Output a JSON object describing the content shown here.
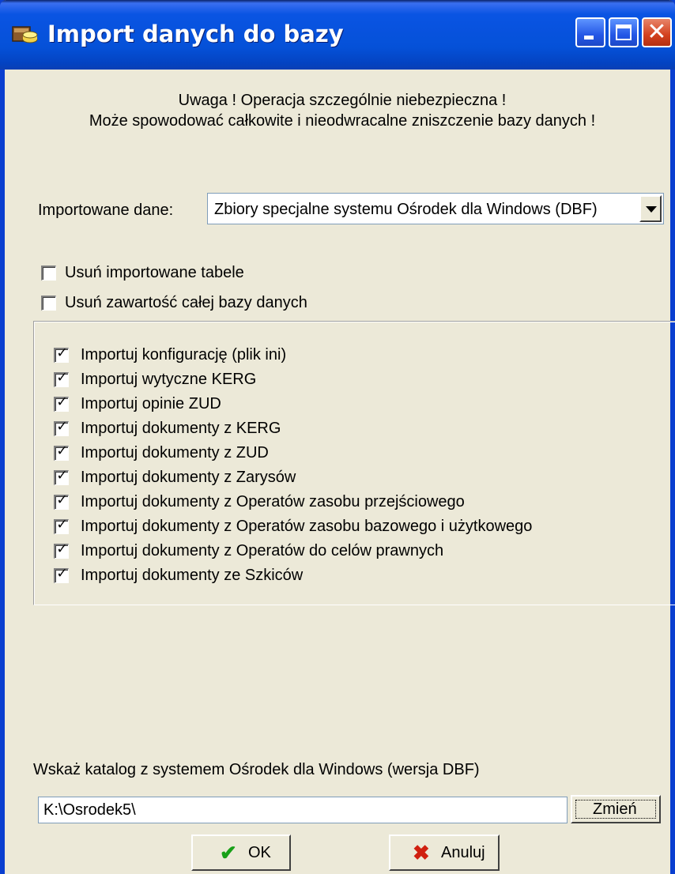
{
  "window": {
    "title": "Import danych do bazy"
  },
  "warning": {
    "line1": "Uwaga ! Operacja szczególnie niebezpieczna !",
    "line2": "Może spowodować całkowite i nieodwracalne zniszczenie bazy danych !"
  },
  "import": {
    "label": "Importowane dane:",
    "selected": "Zbiory specjalne systemu Ośrodek dla Windows (DBF)"
  },
  "options": [
    {
      "label": "Usuń importowane tabele",
      "checked": false
    },
    {
      "label": "Usuń zawartość całej bazy danych",
      "checked": false
    }
  ],
  "import_items": [
    {
      "label": "Importuj konfigurację (plik ini)",
      "checked": true
    },
    {
      "label": "Importuj wytyczne KERG",
      "checked": true
    },
    {
      "label": "Importuj opinie ZUD",
      "checked": true
    },
    {
      "label": "Importuj dokumenty z KERG",
      "checked": true
    },
    {
      "label": "Importuj dokumenty z ZUD",
      "checked": true
    },
    {
      "label": "Importuj dokumenty z Zarysów",
      "checked": true
    },
    {
      "label": "Importuj dokumenty z Operatów zasobu przejściowego",
      "checked": true
    },
    {
      "label": "Importuj dokumenty z Operatów zasobu bazowego i użytkowego",
      "checked": true
    },
    {
      "label": "Importuj dokumenty z Operatów do celów prawnych",
      "checked": true
    },
    {
      "label": "Importuj dokumenty ze Szkiców",
      "checked": true
    }
  ],
  "directory": {
    "label": "Wskaż katalog z systemem Ośrodek dla Windows (wersja DBF)",
    "value": "K:\\Osrodek5\\",
    "change_label": "Zmień"
  },
  "buttons": {
    "ok_label": "OK",
    "cancel_label": "Anuluj"
  },
  "colors": {
    "titlebar": "#0A54E3",
    "face": "#ECE9D8",
    "ok_icon": "#18A018",
    "cancel_icon": "#D02010"
  }
}
